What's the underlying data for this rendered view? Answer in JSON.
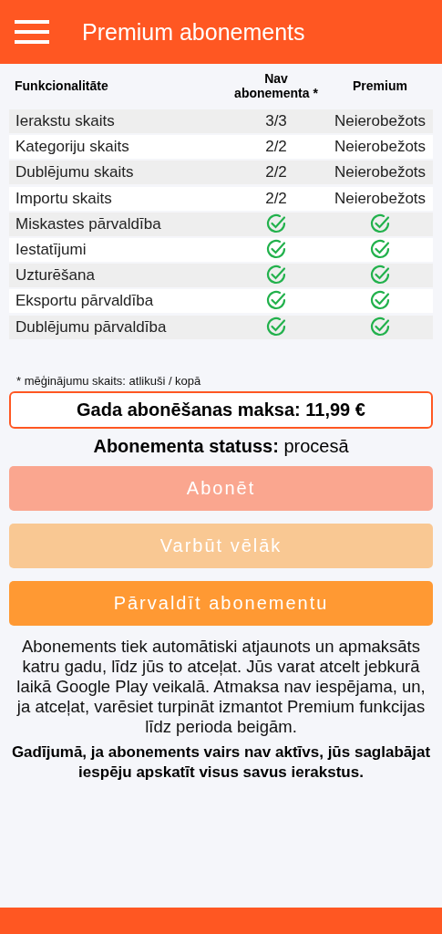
{
  "app_bar": {
    "title": "Premium abonements"
  },
  "table": {
    "columns": [
      "Funkcionalitāte",
      "Nav abonementa *",
      "Premium"
    ],
    "rows": [
      {
        "cells": [
          {
            "kind": "text",
            "text": "Ierakstu skaits"
          },
          {
            "kind": "text",
            "text": "3/3"
          },
          {
            "kind": "text",
            "text": "Neierobežots"
          }
        ]
      },
      {
        "cells": [
          {
            "kind": "text",
            "text": "Kategoriju skaits"
          },
          {
            "kind": "text",
            "text": "2/2"
          },
          {
            "kind": "text",
            "text": "Neierobežots"
          }
        ]
      },
      {
        "cells": [
          {
            "kind": "text",
            "text": "Dublējumu skaits"
          },
          {
            "kind": "text",
            "text": "2/2"
          },
          {
            "kind": "text",
            "text": "Neierobežots"
          }
        ]
      },
      {
        "cells": [
          {
            "kind": "text",
            "text": "Importu skaits"
          },
          {
            "kind": "text",
            "text": "2/2"
          },
          {
            "kind": "text",
            "text": "Neierobežots"
          }
        ]
      },
      {
        "cells": [
          {
            "kind": "text",
            "text": "Miskastes pārvaldība"
          },
          {
            "kind": "check",
            "checked": true
          },
          {
            "kind": "check",
            "checked": true
          }
        ]
      },
      {
        "cells": [
          {
            "kind": "text",
            "text": "Iestatījumi"
          },
          {
            "kind": "check",
            "checked": true
          },
          {
            "kind": "check",
            "checked": true
          }
        ]
      },
      {
        "cells": [
          {
            "kind": "text",
            "text": "Uzturēšana"
          },
          {
            "kind": "check",
            "checked": true
          },
          {
            "kind": "check",
            "checked": true
          }
        ]
      },
      {
        "cells": [
          {
            "kind": "text",
            "text": "Eksportu pārvaldība"
          },
          {
            "kind": "check",
            "checked": true
          },
          {
            "kind": "check",
            "checked": true
          }
        ]
      },
      {
        "cells": [
          {
            "kind": "text",
            "text": "Dublējumu pārvaldība"
          },
          {
            "kind": "check",
            "checked": true
          },
          {
            "kind": "check",
            "checked": true
          }
        ]
      }
    ],
    "footnote": "* mēģinājumu skaits: atlikuši / kopā"
  },
  "price": "Gada abonēšanas maksa: 11,99 €",
  "status": "**Abonementa statuss:** procesā",
  "buttons": [
    {
      "label": "Abonēt",
      "color": "#faa68f"
    },
    {
      "label": "Varbūt vēlāk",
      "color": "#f9c893"
    },
    {
      "label": "Pārvaldīt abonementu",
      "color": "#ff9933"
    }
  ],
  "info": "Abonements tiek automātiski atjaunots un apmaksāts katru gadu, līdz jūs to atceļat. Jūs varat atcelt jebkurā laikā Google Play veikalā. Atmaksa nav iespējama, un, ja atceļat, varēsiet turpināt izmantot Premium funkcijas līdz perioda beigām.",
  "note": "Gadījumā, ja abonements vairs nav aktīvs, jūs saglabājat iespēju apskatīt visus savus ierakstus."
}
